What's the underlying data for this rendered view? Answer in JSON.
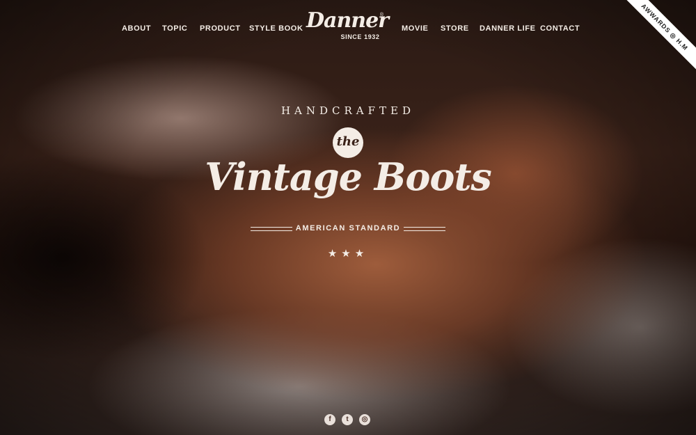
{
  "nav": {
    "left": [
      "ABOUT",
      "TOPIC",
      "PRODUCT",
      "STYLE BOOK"
    ],
    "right": [
      "MOVIE",
      "STORE",
      "DANNER LIFE",
      "CONTACT"
    ]
  },
  "logo": {
    "wordmark": "Danner",
    "registered": "®",
    "tagline": "SINCE 1932"
  },
  "ribbon": {
    "text": "AWWARDS ◎ H.M"
  },
  "hero": {
    "eyebrow": "HANDCRAFTED",
    "badge": "the",
    "title": "Vintage Boots",
    "subtitle": "AMERICAN STANDARD",
    "stars": "★★★"
  },
  "social": [
    {
      "icon": "facebook-icon",
      "glyph": "f"
    },
    {
      "icon": "twitter-icon",
      "glyph": "t"
    },
    {
      "icon": "instagram-icon",
      "glyph": "◎"
    }
  ],
  "colors": {
    "text": "#f4ede6",
    "leather": "#a4603e",
    "dark": "#1a0f0b"
  }
}
